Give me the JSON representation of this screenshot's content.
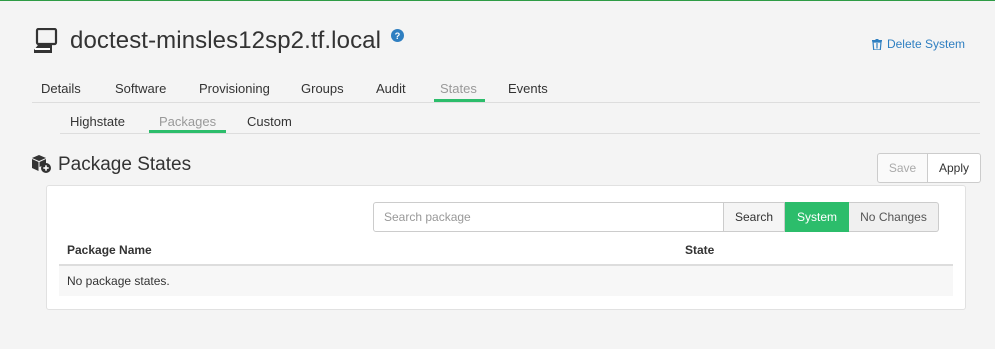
{
  "header": {
    "title": "doctest-minsles12sp2.tf.local",
    "delete_label": "Delete System",
    "icons": [
      "system-icon",
      "help-icon",
      "trash-icon"
    ]
  },
  "tabs": [
    {
      "label": "Details"
    },
    {
      "label": "Software"
    },
    {
      "label": "Provisioning"
    },
    {
      "label": "Groups"
    },
    {
      "label": "Audit"
    },
    {
      "label": "States",
      "active": true
    },
    {
      "label": "Events"
    }
  ],
  "subtabs": [
    {
      "label": "Highstate"
    },
    {
      "label": "Packages",
      "active": true
    },
    {
      "label": "Custom"
    }
  ],
  "section": {
    "title": "Package States",
    "save_label": "Save",
    "apply_label": "Apply"
  },
  "search": {
    "placeholder": "Search package",
    "search_label": "Search",
    "system_label": "System",
    "no_changes_label": "No Changes"
  },
  "table": {
    "columns": [
      "Package Name",
      "State"
    ],
    "empty_text": "No package states."
  },
  "colors": {
    "accent": "#2cbd6b",
    "link": "#2f7fc1",
    "top_line": "#2e9c45"
  }
}
